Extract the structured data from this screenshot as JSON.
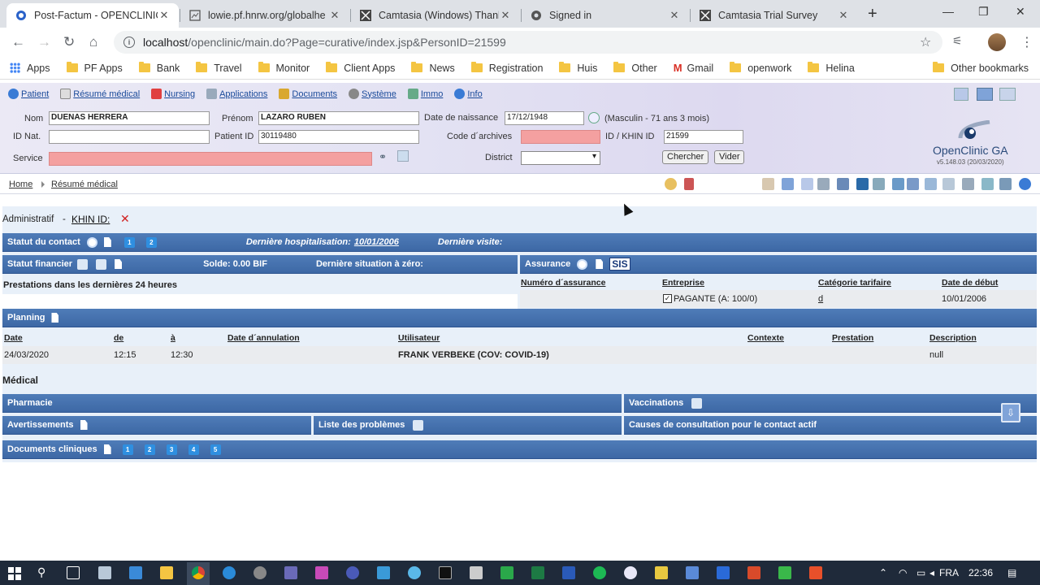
{
  "browser": {
    "tabs": [
      {
        "title": "Post-Factum - OPENCLINIC",
        "active": true
      },
      {
        "title": "lowie.pf.hnrw.org/globalhe"
      },
      {
        "title": "Camtasia (Windows) Thank"
      },
      {
        "title": "Signed in"
      },
      {
        "title": "Camtasia Trial Survey"
      }
    ],
    "url_host": "localhost",
    "url_rest": "/openclinic/main.do?Page=curative/index.jsp&PersonID=21599",
    "bookmarks": [
      "Apps",
      "PF Apps",
      "Bank",
      "Travel",
      "Monitor",
      "Client Apps",
      "News",
      "Registration",
      "Huis",
      "Other",
      "Gmail",
      "openwork",
      "Helina"
    ],
    "other_bookmarks": "Other bookmarks"
  },
  "menu": [
    "Patient",
    "Résumé médical",
    "Nursing",
    "Applications",
    "Documents",
    "Système",
    "Immo",
    "Info"
  ],
  "patient": {
    "nom_label": "Nom",
    "nom": "DUENAS HERRERA",
    "prenom_label": "Prénom",
    "prenom": "LAZARO RUBEN",
    "dob_label": "Date de naissance",
    "dob": "17/12/1948",
    "gender_age": "(Masculin - 71 ans 3 mois)",
    "idnat_label": "ID Nat.",
    "idnat": "",
    "patientid_label": "Patient ID",
    "patientid": "30119480",
    "archives_label": "Code d´archives",
    "khin_label": "ID / KHIN ID",
    "khin": "21599",
    "service_label": "Service",
    "district_label": "District",
    "search_btn": "Chercher",
    "clear_btn": "Vider"
  },
  "logo": {
    "name": "OpenClinic GA",
    "version": "v5.148.03 (20/03/2020)"
  },
  "breadcrumb": [
    "Home",
    "Résumé médical"
  ],
  "admin": {
    "label": "Administratif",
    "khin_link": "KHIN ID:"
  },
  "contact": {
    "title": "Statut du contact",
    "badges": [
      "1",
      "2"
    ],
    "last_hosp_label": "Dernière hospitalisation:",
    "last_hosp": "10/01/2006",
    "last_visit_label": "Dernière visite:"
  },
  "financial": {
    "title": "Statut financier",
    "solde": "Solde: 0.00 BIF",
    "zero_label": "Dernière situation à zéro:",
    "prestations": "Prestations dans les dernières 24 heures"
  },
  "insurance": {
    "title": "Assurance",
    "sis": "SIS",
    "columns": [
      "Numéro d´assurance",
      "Entreprise",
      "Catégorie tarifaire",
      "Date de début"
    ],
    "row": {
      "numero": "",
      "entreprise": "PAGANTE (A: 100/0)",
      "categorie": "d",
      "debut": "10/01/2006"
    }
  },
  "planning": {
    "title": "Planning",
    "columns": [
      "Date",
      "de",
      "à",
      "Date d´annulation",
      "Utilisateur",
      "Contexte",
      "Prestation",
      "Description"
    ],
    "row": {
      "date": "24/03/2020",
      "de": "12:15",
      "a": "12:30",
      "annulation": "",
      "utilisateur": "FRANK VERBEKE (COV: COVID-19)",
      "contexte": "",
      "prestation": "",
      "description": "null"
    }
  },
  "medical": {
    "label": "Médical",
    "pharmacie": "Pharmacie",
    "vaccinations": "Vaccinations",
    "avertissements": "Avertissements",
    "problemes": "Liste des problèmes",
    "causes": "Causes de consultation pour le contact actif",
    "documents": "Documents cliniques",
    "doc_badges": [
      "1",
      "2",
      "3",
      "4",
      "5"
    ]
  },
  "taskbar": {
    "lang": "FRA",
    "time": "22:36"
  },
  "colors": {
    "bar": "#3d68a5",
    "content_bg": "#e8f0f9",
    "pink_field": "#f4a0a0"
  }
}
